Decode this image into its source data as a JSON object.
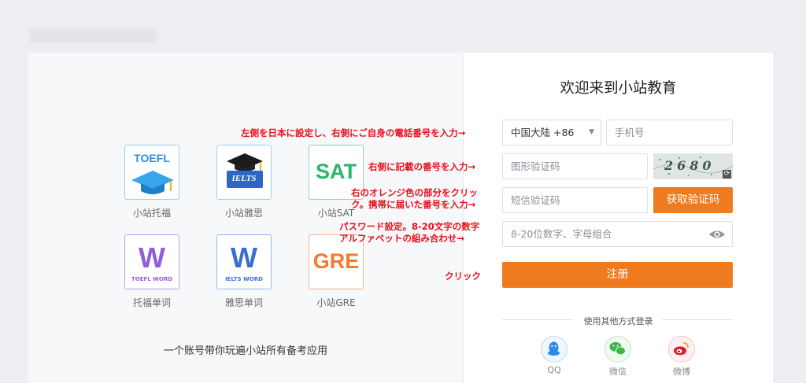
{
  "header": {
    "blurred_text": ""
  },
  "left_panel": {
    "apps": [
      {
        "label": "小站托福",
        "icon": "toefl-icon",
        "tile_text": "TOEFL"
      },
      {
        "label": "小站雅思",
        "icon": "ielts-icon",
        "tile_text": "IELTS"
      },
      {
        "label": "小站SAT",
        "icon": "sat-icon",
        "tile_text": "SAT"
      },
      {
        "label": "托福单词",
        "icon": "toefl-word-icon",
        "tile_letter": "W",
        "tile_caption": "TOEFL WORD"
      },
      {
        "label": "雅思单词",
        "icon": "ielts-word-icon",
        "tile_letter": "W",
        "tile_caption": "IELTS WORD"
      },
      {
        "label": "小站GRE",
        "icon": "gre-icon",
        "tile_text": "GRE"
      }
    ],
    "slogan": "一个账号带你玩遍小站所有备考应用"
  },
  "annotations": {
    "country": "左側を日本に設定し、右側にご自身の電話番号を入力→",
    "captcha": "右側に記載の番号を入力→",
    "sms_line1": "右のオレンジ色の部分をクリッ",
    "sms_line2": "ク。携帯に届いた番号を入力→",
    "pwd_line1": "パスワード設定。8-20文字の数字",
    "pwd_line2": "アルファベットの組み合わせ→",
    "click": "クリック"
  },
  "form": {
    "title": "欢迎来到小站教育",
    "country_select": "中国大陆 +86",
    "phone_placeholder": "手机号",
    "captcha_placeholder": "图形验证码",
    "captcha_code": "2680",
    "sms_placeholder": "短信验证码",
    "sms_button": "获取验证码",
    "password_placeholder": "8-20位数字、字母组合",
    "register_button": "注册",
    "other_login": "使用其他方式登录",
    "social": [
      {
        "name": "qq-icon",
        "label": "QQ",
        "color": "#2b8be8"
      },
      {
        "name": "wechat-icon",
        "label": "微信",
        "color": "#3bb54a"
      },
      {
        "name": "weibo-icon",
        "label": "微博",
        "color": "#e6162d"
      }
    ]
  },
  "colors": {
    "accent": "#f07a1e",
    "annotation": "#e8101c"
  }
}
